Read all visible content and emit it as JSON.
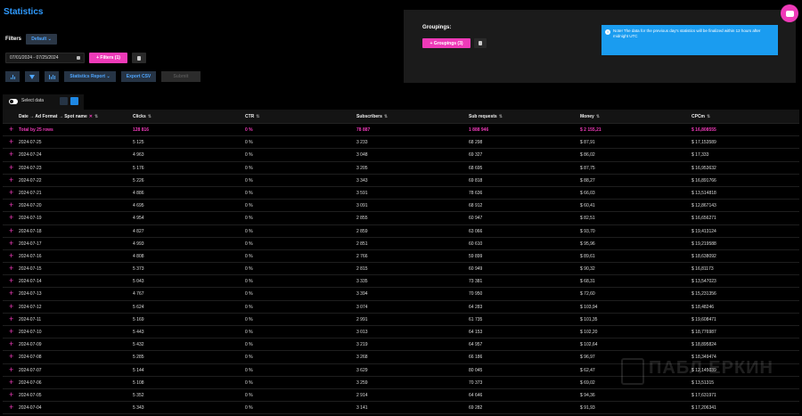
{
  "title": "Statistics",
  "filters": {
    "label": "Filters",
    "default_button": "Default ⌄",
    "date_range": "07/01/2024 - 07/25/2024",
    "filters_button": "+ Filters (1)"
  },
  "toolbar": {
    "report_button": "Statistics Report ⌄",
    "export_button": "Export CSV",
    "submit_button": "Submit"
  },
  "groupings": {
    "label": "Groupings:",
    "button": "+ Groupings (3)"
  },
  "note": {
    "text": "Note! The data for the previous day's statistics will be finalized within 12 hours after midnight UTC"
  },
  "select_data": {
    "label": "Select data"
  },
  "table": {
    "columns": [
      {
        "label": "Date → Ad Format → Spot name",
        "removable": true
      },
      {
        "label": "Clicks"
      },
      {
        "label": "CTR"
      },
      {
        "label": "Subscribers"
      },
      {
        "label": "Sub requests"
      },
      {
        "label": "Money"
      },
      {
        "label": "CPCm"
      }
    ],
    "total": [
      "Total by 25 rows",
      "128 816",
      "0 %",
      "78 887",
      "1 888 946",
      "$ 2 155,21",
      "$ 16,808555"
    ],
    "rows": [
      [
        "2024-07-25",
        "5 125",
        "0 %",
        "3 233",
        "68 298",
        "$ 87,91",
        "$ 17,153589"
      ],
      [
        "2024-07-24",
        "4 963",
        "0 %",
        "3 048",
        "69 327",
        "$ 86,02",
        "$ 17,333"
      ],
      [
        "2024-07-23",
        "5 176",
        "0 %",
        "3 205",
        "68 695",
        "$ 87,75",
        "$ 16,953632"
      ],
      [
        "2024-07-22",
        "5 226",
        "0 %",
        "3 343",
        "69 818",
        "$ 88,27",
        "$ 16,891766"
      ],
      [
        "2024-07-21",
        "4 886",
        "0 %",
        "3 591",
        "78 636",
        "$ 66,03",
        "$ 13,514818"
      ],
      [
        "2024-07-20",
        "4 695",
        "0 %",
        "3 091",
        "68 912",
        "$ 60,41",
        "$ 12,867143"
      ],
      [
        "2024-07-19",
        "4 954",
        "0 %",
        "2 855",
        "60 947",
        "$ 82,51",
        "$ 16,656271"
      ],
      [
        "2024-07-18",
        "4 827",
        "0 %",
        "2 859",
        "63 066",
        "$ 93,70",
        "$ 19,413124"
      ],
      [
        "2024-07-17",
        "4 993",
        "0 %",
        "2 851",
        "60 610",
        "$ 95,96",
        "$ 19,219588"
      ],
      [
        "2024-07-16",
        "4 808",
        "0 %",
        "2 766",
        "59 899",
        "$ 89,61",
        "$ 18,638092"
      ],
      [
        "2024-07-15",
        "5 373",
        "0 %",
        "2 815",
        "60 949",
        "$ 90,32",
        "$ 16,81173"
      ],
      [
        "2024-07-14",
        "5 043",
        "0 %",
        "3 335",
        "73 381",
        "$ 68,31",
        "$ 13,547023"
      ],
      [
        "2024-07-13",
        "4 767",
        "0 %",
        "3 394",
        "70 950",
        "$ 72,60",
        "$ 15,231356"
      ],
      [
        "2024-07-12",
        "5 624",
        "0 %",
        "3 074",
        "64 283",
        "$ 103,94",
        "$ 18,48246"
      ],
      [
        "2024-07-11",
        "5 169",
        "0 %",
        "2 991",
        "61 735",
        "$ 101,35",
        "$ 19,608471"
      ],
      [
        "2024-07-10",
        "5 443",
        "0 %",
        "3 013",
        "64 153",
        "$ 102,20",
        "$ 18,776987"
      ],
      [
        "2024-07-09",
        "5 432",
        "0 %",
        "3 219",
        "64 957",
        "$ 102,64",
        "$ 18,895824"
      ],
      [
        "2024-07-08",
        "5 285",
        "0 %",
        "3 268",
        "66 186",
        "$ 96,97",
        "$ 18,349474"
      ],
      [
        "2024-07-07",
        "5 144",
        "0 %",
        "3 629",
        "80 045",
        "$ 62,47",
        "$ 12,145039"
      ],
      [
        "2024-07-06",
        "5 108",
        "0 %",
        "3 259",
        "70 373",
        "$ 69,02",
        "$ 13,51315"
      ],
      [
        "2024-07-05",
        "5 352",
        "0 %",
        "2 914",
        "64 646",
        "$ 94,36",
        "$ 17,631971"
      ],
      [
        "2024-07-04",
        "5 343",
        "0 %",
        "3 141",
        "69 282",
        "$ 91,93",
        "$ 17,206341"
      ]
    ]
  },
  "watermark": "ПАБЛ ЕРКИН"
}
